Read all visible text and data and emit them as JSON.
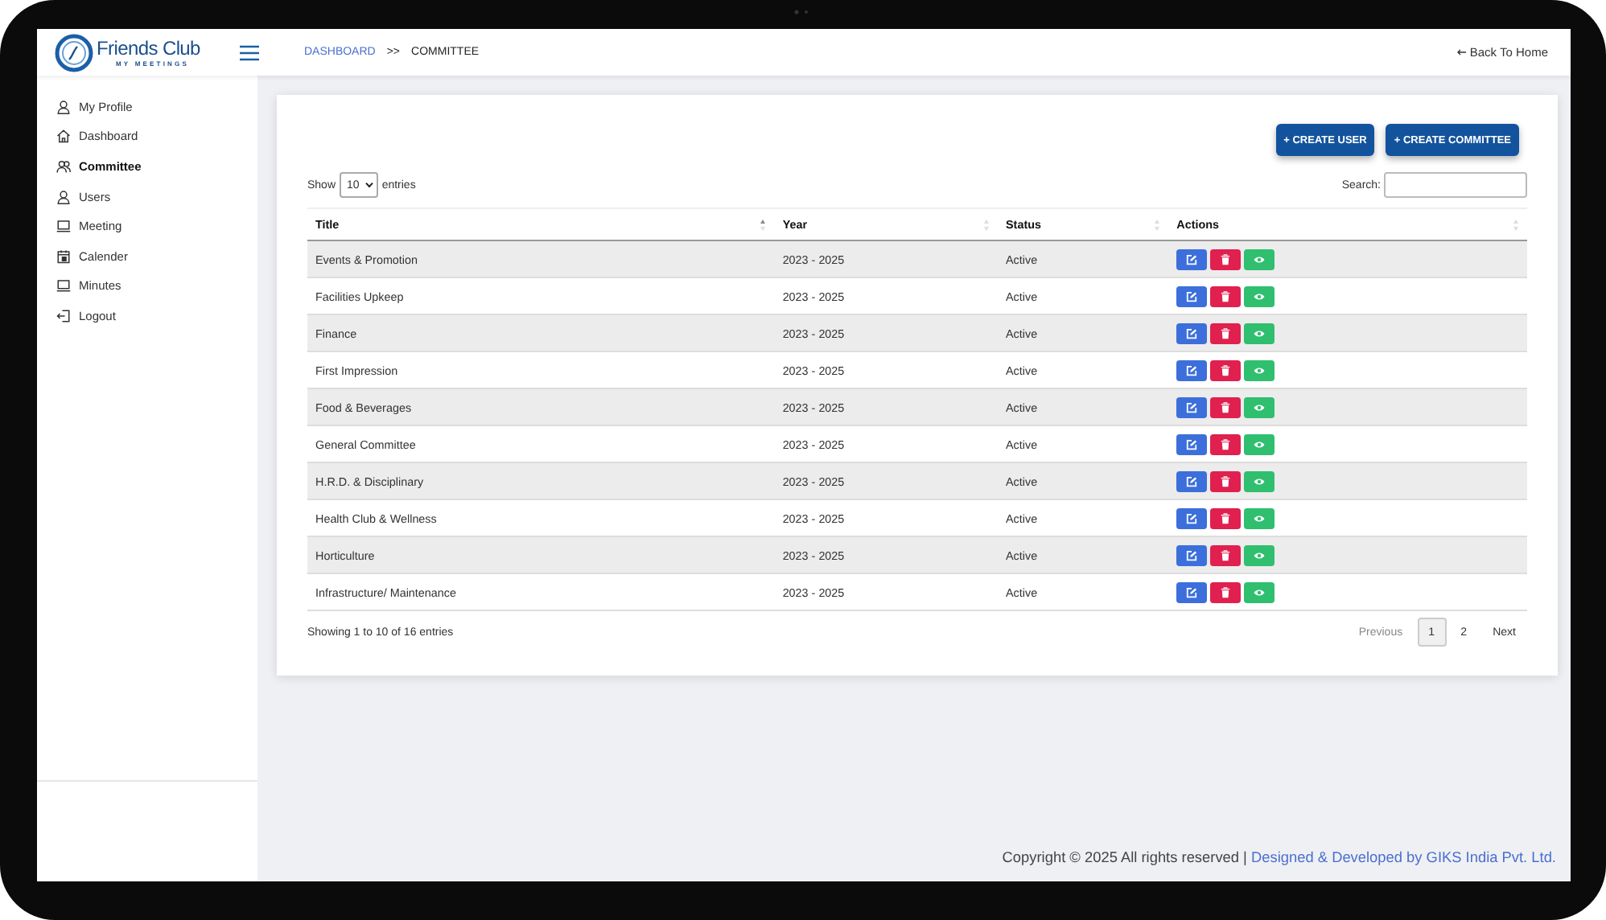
{
  "header": {
    "logo": {
      "title": "Friends Club",
      "subtitle": "MY MEETINGS"
    },
    "breadcrumb": [
      {
        "label": "DASHBOARD",
        "link": true
      },
      {
        "label": ">>",
        "link": false
      },
      {
        "label": "COMMITTEE",
        "link": false
      }
    ],
    "back_link": "Back To Home"
  },
  "sidebar": {
    "items": [
      {
        "label": "My Profile",
        "kind": "person",
        "selected": false
      },
      {
        "label": "Dashboard",
        "kind": "home",
        "selected": false
      },
      {
        "label": "Committee",
        "kind": "group",
        "selected": true
      },
      {
        "label": "Users",
        "kind": "person",
        "selected": false
      },
      {
        "label": "Meeting",
        "kind": "laptop",
        "selected": false
      },
      {
        "label": "Calender",
        "kind": "calendar",
        "selected": false
      },
      {
        "label": "Minutes",
        "kind": "laptop",
        "selected": false
      },
      {
        "label": "Logout",
        "kind": "logout",
        "selected": false
      }
    ]
  },
  "buttons": [
    "+ CREATE USER",
    "+ CREATE COMMITTEE"
  ],
  "table_controls": {
    "show_label": "Show",
    "page_size": "10",
    "entries_label": "entries",
    "search_label": "Search:"
  },
  "table": {
    "columns": [
      {
        "label": "Title",
        "sorted": true
      },
      {
        "label": "Year",
        "sorted": false
      },
      {
        "label": "Status",
        "sorted": false
      },
      {
        "label": "Actions",
        "sorted": false
      }
    ],
    "rows": [
      [
        "Events & Promotion",
        "2023 - 2025",
        "Active"
      ],
      [
        "Facilities Upkeep",
        "2023 - 2025",
        "Active"
      ],
      [
        "Finance",
        "2023 - 2025",
        "Active"
      ],
      [
        "First Impression",
        "2023 - 2025",
        "Active"
      ],
      [
        "Food & Beverages",
        "2023 - 2025",
        "Active"
      ],
      [
        "General Committee",
        "2023 - 2025",
        "Active"
      ],
      [
        "H.R.D. & Disciplinary",
        "2023 - 2025",
        "Active"
      ],
      [
        "Health Club & Wellness",
        "2023 - 2025",
        "Active"
      ],
      [
        "Horticulture",
        "2023 - 2025",
        "Active"
      ],
      [
        "Infrastructure/ Maintenance",
        "2023 - 2025",
        "Active"
      ]
    ]
  },
  "table_info": "Showing 1 to 10 of 16 entries",
  "pagination": [
    {
      "label": "Previous",
      "kind": "nav",
      "disabled": true,
      "selected": false
    },
    {
      "label": "1",
      "kind": "page",
      "disabled": false,
      "selected": true
    },
    {
      "label": "2",
      "kind": "page",
      "disabled": false,
      "selected": false
    },
    {
      "label": "Next",
      "kind": "nav",
      "disabled": false,
      "selected": false
    }
  ],
  "footer": {
    "copyright": "Copyright © 2025 All rights reserved |",
    "credit": "Designed & Developed by GIKS India Pvt. Ltd."
  }
}
